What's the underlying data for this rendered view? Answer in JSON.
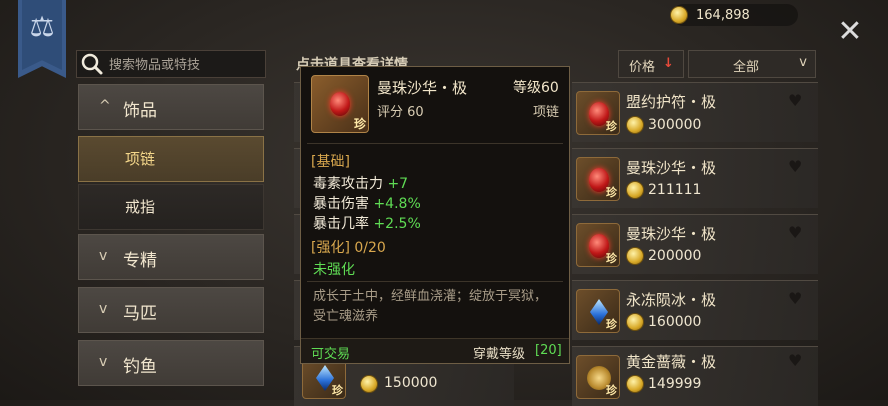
{
  "currency": {
    "amount": "164,898"
  },
  "search": {
    "placeholder": "搜索物品或特技"
  },
  "categories": [
    {
      "label": "饰品",
      "chev": "^"
    },
    {
      "label": "项链"
    },
    {
      "label": "戒指"
    },
    {
      "label": "专精",
      "chev": "v"
    },
    {
      "label": "马匹",
      "chev": "v"
    },
    {
      "label": "钓鱼",
      "chev": "v"
    }
  ],
  "header": {
    "partial_title": "点击道具查看详情",
    "sort_label": "价格",
    "sort_arrow": "↓",
    "filter_label": "全部",
    "filter_chev": "v"
  },
  "items": [
    {
      "name": "盟约护符・极",
      "price": "300000",
      "badge": "珍"
    },
    {
      "name": "曼珠沙华・极",
      "price": "211111",
      "badge": "珍"
    },
    {
      "name": "曼珠沙华・极",
      "price": "200000",
      "badge": "珍"
    },
    {
      "name": "永冻陨冰・极",
      "price": "160000",
      "badge": "珍"
    },
    {
      "name": "黄金蔷薇・极",
      "price": "149999",
      "badge": "珍"
    }
  ],
  "hidden_row": {
    "price": "150000",
    "badge": "珍"
  },
  "tooltip": {
    "name": "曼珠沙华・极",
    "level": "等级60",
    "score": "评分 60",
    "type": "项链",
    "badge": "珍",
    "base_header": "[基础]",
    "stats": [
      {
        "label": "毒素攻击力",
        "value": "+7"
      },
      {
        "label": "暴击伤害",
        "value": "+4.8%"
      },
      {
        "label": "暴击几率",
        "value": "+2.5%"
      }
    ],
    "enhance_header": "[强化] 0/20",
    "enhance_status": "未强化",
    "flavor": "成长于土中，经鲜血浇灌；绽放于冥狱，受亡魂滋养",
    "tradeable": "可交易",
    "wear_req_label": "穿戴等级",
    "wear_req_value": "[20]"
  },
  "icons": [
    "scale-icon",
    "coin-icon",
    "close-icon",
    "search-icon",
    "heart-icon",
    "gem-icon"
  ]
}
